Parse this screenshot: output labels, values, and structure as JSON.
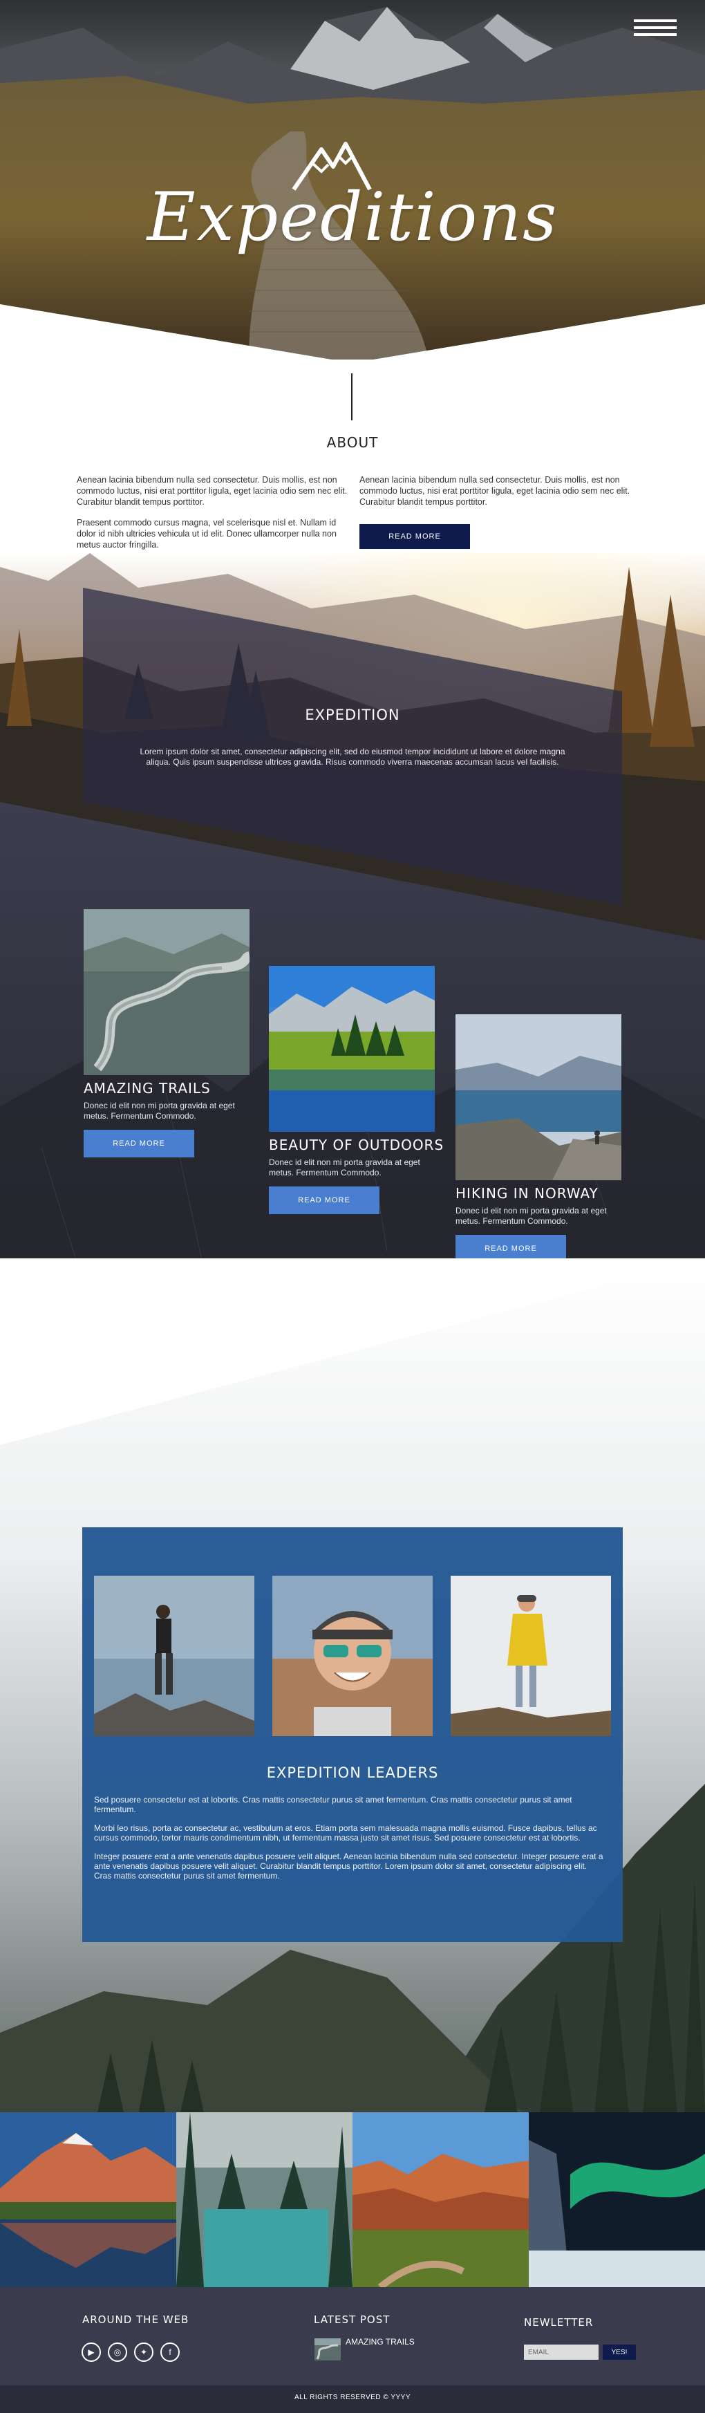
{
  "hero": {
    "brand": "Expeditions",
    "menu_icon": "hamburger-menu-icon",
    "logo_icon": "mountain-logo-icon"
  },
  "about": {
    "title": "ABOUT",
    "col_left": [
      "Aenean lacinia bibendum nulla sed consectetur. Duis mollis, est non commodo luctus, nisi erat porttitor ligula, eget lacinia odio sem nec elit. Curabitur blandit tempus porttitor.",
      "Praesent commodo cursus magna, vel scelerisque nisl et. Nullam id dolor id nibh ultricies vehicula ut id elit. Donec ullamcorper nulla non metus auctor fringilla."
    ],
    "col_right": [
      "Aenean lacinia bibendum nulla sed consectetur. Duis mollis, est non commodo luctus, nisi erat porttitor ligula, eget lacinia odio sem nec elit. Curabitur blandit tempus porttitor."
    ],
    "button": "READ MORE"
  },
  "expedition": {
    "title": "EXPEDITION",
    "text": "Lorem ipsum dolor sit amet, consectetur adipiscing elit, sed do eiusmod tempor incididunt ut labore et dolore magna aliqua. Quis ipsum suspendisse ultrices gravida. Risus commodo viverra maecenas accumsan lacus vel facilisis."
  },
  "cards": [
    {
      "title": "AMAZING TRAILS",
      "text": "Donec id elit non mi porta gravida at eget metus. Fermentum Commodo.",
      "button": "READ MORE"
    },
    {
      "title": "BEAUTY OF OUTDOORS",
      "text": "Donec id elit non mi porta gravida at eget metus. Fermentum Commodo.",
      "button": "READ MORE"
    },
    {
      "title": "HIKING IN NORWAY",
      "text": "Donec id elit non mi porta gravida at eget metus. Fermentum Commodo.",
      "button": "READ MORE"
    }
  ],
  "leaders": {
    "title": "EXPEDITION LEADERS",
    "paragraphs": [
      "Sed posuere consectetur est at lobortis. Cras mattis consectetur purus sit amet fermentum. Cras mattis consectetur purus sit amet fermentum.",
      "Morbi leo risus, porta ac consectetur ac, vestibulum at eros. Etiam porta sem malesuada magna mollis euismod. Fusce dapibus, tellus ac cursus commodo, tortor mauris condimentum nibh, ut fermentum massa justo sit amet risus. Sed posuere consectetur est at lobortis.",
      "Integer posuere erat a ante venenatis dapibus posuere velit aliquet. Aenean lacinia bibendum nulla sed consectetur. Integer posuere erat a ante venenatis dapibus posuere velit aliquet. Curabitur blandit tempus porttitor. Lorem ipsum dolor sit amet, consectetur adipiscing elit. Cras mattis consectetur purus sit amet fermentum."
    ]
  },
  "footer": {
    "around_title": "AROUND THE WEB",
    "social_icons": [
      "youtube-icon",
      "instagram-icon",
      "twitter-icon",
      "facebook-icon"
    ],
    "latest_title": "LATEST POST",
    "latest_post": "AMAZING TRAILS",
    "newsletter_title": "NEWLETTER",
    "email_placeholder": "EMAIL",
    "subscribe_button": "YES!",
    "copyright": "ALL RIGHTS RESERVED © YYYY"
  },
  "colors": {
    "navy": "#0f1a4d",
    "button_blue": "#4a7fd0",
    "leaders_blue": "#245894",
    "footer": "#3a3b4d"
  }
}
